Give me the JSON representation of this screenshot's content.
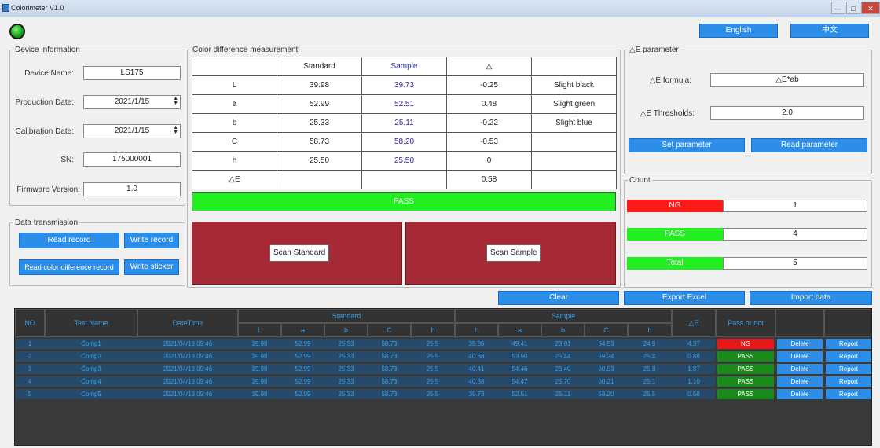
{
  "window": {
    "title": "Colorimeter V1.0",
    "buttons": [
      "—",
      "□",
      "✕"
    ]
  },
  "top_buttons": {
    "language": "English",
    "other": "中文"
  },
  "device_info": {
    "legend": "Device information",
    "name_label": "Device Name:",
    "name_value": "LS175",
    "prod_label": "Production Date:",
    "prod_value": "2021/1/15",
    "cal_label": "Calibration Date:",
    "cal_value": "2021/1/15",
    "sn_label": "SN:",
    "sn_value": "175000001",
    "fw_label": "Firmware Version:",
    "fw_value": "1.0"
  },
  "data_transmission": {
    "legend": "Data transmission",
    "read_record": "Read record",
    "write_record": "Write record",
    "read_color": "Read color difference record",
    "write_sticker": "Write sticker"
  },
  "cdm": {
    "legend": "Color difference measurement",
    "headers": [
      "",
      "Standard",
      "Sample",
      "△",
      ""
    ],
    "rows": [
      {
        "name": "L",
        "std": "39.98",
        "sam": "39.73",
        "diff": "-0.25",
        "desc": "Slight black"
      },
      {
        "name": "a",
        "std": "52.99",
        "sam": "52.51",
        "diff": "0.48",
        "desc": "Slight green"
      },
      {
        "name": "b",
        "std": "25.33",
        "sam": "25.11",
        "diff": "-0.22",
        "desc": "Slight blue"
      },
      {
        "name": "C",
        "std": "58.73",
        "sam": "58.20",
        "diff": "-0.53",
        "desc": ""
      },
      {
        "name": "h",
        "std": "25.50",
        "sam": "25.50",
        "diff": "0",
        "desc": ""
      },
      {
        "name": "△E",
        "std": "",
        "sam": "",
        "diff": "0.58",
        "desc": ""
      }
    ],
    "result": "PASS",
    "scan_standard": "Scan Standard",
    "scan_sample": "Scan Sample"
  },
  "e_param": {
    "legend": "△E parameter",
    "formula_label": "△E formula:",
    "formula_value": "△E*ab",
    "threshold_label": "△E Thresholds:",
    "threshold_value": "2.0",
    "set_btn": "Set parameter",
    "read_btn": "Read parameter"
  },
  "count": {
    "legend": "Count",
    "rows": [
      {
        "label": "NG",
        "value": "1",
        "color": "#ff1a1a"
      },
      {
        "label": "PASS",
        "value": "4",
        "color": "#22ee22"
      },
      {
        "label": "Total",
        "value": "5",
        "color": "#22ee22"
      }
    ]
  },
  "actions": {
    "clear": "Clear",
    "export": "Export Excel",
    "import": "Import data"
  },
  "grid": {
    "headers": {
      "no": "NO",
      "test_name": "Test Name",
      "datetime": "DateTime",
      "standard": "Standard",
      "sample": "Sample",
      "de": "△E",
      "pass": "Pass or not"
    },
    "sub": [
      "L",
      "a",
      "b",
      "C",
      "h",
      "L",
      "a",
      "b",
      "C",
      "h"
    ],
    "rows": [
      {
        "no": "1",
        "name": "Comp1",
        "dt": "2021/04/13 09:46",
        "v": [
          "39.98",
          "52.99",
          "25.33",
          "58.73",
          "25.5",
          "35.85",
          "49.41",
          "23.01",
          "54.53",
          "24.9"
        ],
        "de": "4.37",
        "pf": "NG",
        "pfc": "#e81818",
        "del": "Delete",
        "rep": "Report"
      },
      {
        "no": "2",
        "name": "Comp2",
        "dt": "2021/04/13 09:46",
        "v": [
          "39.98",
          "52.99",
          "25.33",
          "58.73",
          "25.5",
          "40.68",
          "53.50",
          "25.44",
          "59.24",
          "25.4"
        ],
        "de": "0.88",
        "pf": "PASS",
        "pfc": "#1a8a1a",
        "del": "Delete",
        "rep": "Report"
      },
      {
        "no": "3",
        "name": "Comp3",
        "dt": "2021/04/13 09:46",
        "v": [
          "39.98",
          "52.99",
          "25.33",
          "58.73",
          "25.5",
          "40.41",
          "54.46",
          "26.40",
          "60.53",
          "25.8"
        ],
        "de": "1.87",
        "pf": "PASS",
        "pfc": "#1a8a1a",
        "del": "Delete",
        "rep": "Report"
      },
      {
        "no": "4",
        "name": "Comp4",
        "dt": "2021/04/13 09:46",
        "v": [
          "39.98",
          "52.99",
          "25.33",
          "58.73",
          "25.5",
          "40.38",
          "54.47",
          "25.70",
          "60.21",
          "25.1"
        ],
        "de": "1.10",
        "pf": "PASS",
        "pfc": "#1a8a1a",
        "del": "Delete",
        "rep": "Report"
      },
      {
        "no": "5",
        "name": "Comp5",
        "dt": "2021/04/13 09:46",
        "v": [
          "39.98",
          "52.99",
          "25.33",
          "58.73",
          "25.5",
          "39.73",
          "52.51",
          "25.11",
          "58.20",
          "25.5"
        ],
        "de": "0.58",
        "pf": "PASS",
        "pfc": "#1a8a1a",
        "del": "Delete",
        "rep": "Report"
      }
    ]
  }
}
